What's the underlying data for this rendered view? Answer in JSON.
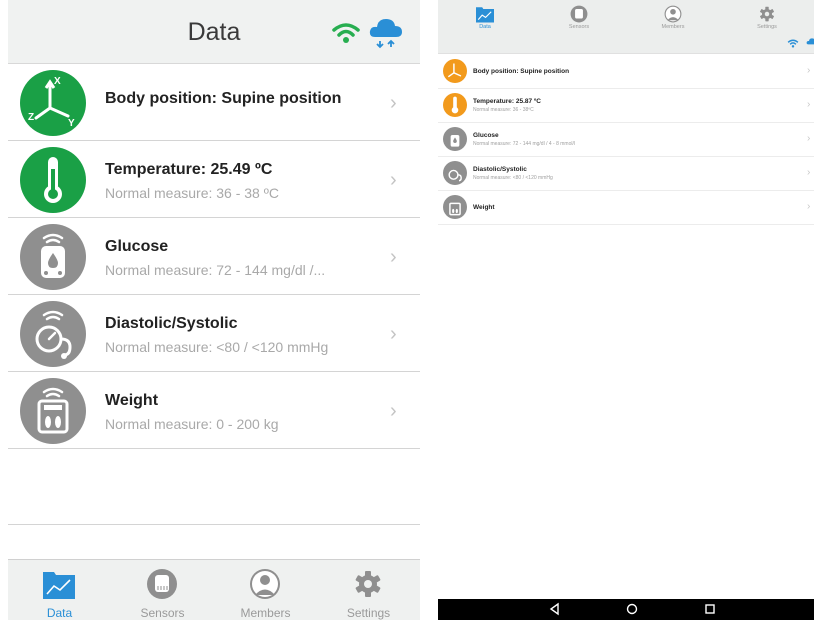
{
  "ios": {
    "header": {
      "title": "Data"
    },
    "rows": [
      {
        "title": "Body position: Supine position",
        "subtitle": ""
      },
      {
        "title": "Temperature: 25.49 ºC",
        "subtitle": "Normal measure: 36 - 38 ºC"
      },
      {
        "title": "Glucose",
        "subtitle": "Normal measure: 72 - 144 mg/dl /..."
      },
      {
        "title": "Diastolic/Systolic",
        "subtitle": "Normal measure: <80 / <120 mmHg"
      },
      {
        "title": "Weight",
        "subtitle": "Normal measure: 0 - 200 kg"
      }
    ],
    "chevron": "›",
    "tabs": [
      {
        "label": "Data",
        "icon": "chart-icon",
        "active": true
      },
      {
        "label": "Sensors",
        "icon": "sensor-icon",
        "active": false
      },
      {
        "label": "Members",
        "icon": "person-icon",
        "active": false
      },
      {
        "label": "Settings",
        "icon": "gear-icon",
        "active": false
      }
    ]
  },
  "android": {
    "tabs": [
      {
        "label": "Data",
        "icon": "chart-icon",
        "active": true
      },
      {
        "label": "Sensors",
        "icon": "sensor-icon",
        "active": false
      },
      {
        "label": "Members",
        "icon": "person-icon",
        "active": false
      },
      {
        "label": "Settings",
        "icon": "gear-icon",
        "active": false
      }
    ],
    "rows": [
      {
        "title": "Body position: Supine position",
        "subtitle": ""
      },
      {
        "title": "Temperature: 25.87 ºC",
        "subtitle": "Normal measure: 36 - 38ºC"
      },
      {
        "title": "Glucose",
        "subtitle": "Normal measure: 72 - 144 mg/dl / 4 - 8 mmol/l"
      },
      {
        "title": "Diastolic/Systolic",
        "subtitle": "Normal measure: <80 / <120 mmHg"
      },
      {
        "title": "Weight",
        "subtitle": ""
      }
    ],
    "chevron": "›",
    "nav": [
      "back-icon",
      "home-icon",
      "recents-icon"
    ]
  },
  "colors": {
    "green": "#1aa046",
    "orange": "#f29a1c",
    "gray_icon": "#8f8f8f",
    "accent_blue": "#2a8fd6"
  }
}
